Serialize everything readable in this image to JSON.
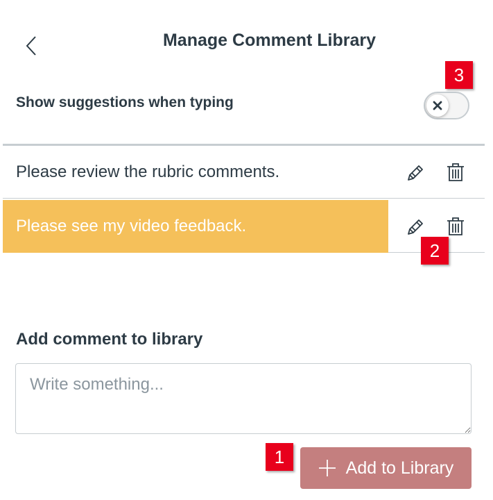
{
  "header": {
    "title": "Manage Comment Library",
    "back_icon": "chevron-left-icon"
  },
  "suggestions": {
    "label": "Show suggestions when typing",
    "enabled": false,
    "toggle_icon": "x-icon"
  },
  "comments": [
    {
      "text": "Please review the rubric comments.",
      "highlighted": false
    },
    {
      "text": "Please see my video feedback.",
      "highlighted": true
    }
  ],
  "add_section": {
    "label": "Add comment to library",
    "placeholder": "Write something...",
    "value": "",
    "button_label": "Add to Library",
    "button_icon": "plus-icon"
  },
  "callouts": [
    "1",
    "2",
    "3"
  ],
  "colors": {
    "highlight": "#f5c05a",
    "button": "#c47f7f",
    "badge": "#e8001c",
    "text": "#2d3b45",
    "border": "#c7cdd1"
  }
}
